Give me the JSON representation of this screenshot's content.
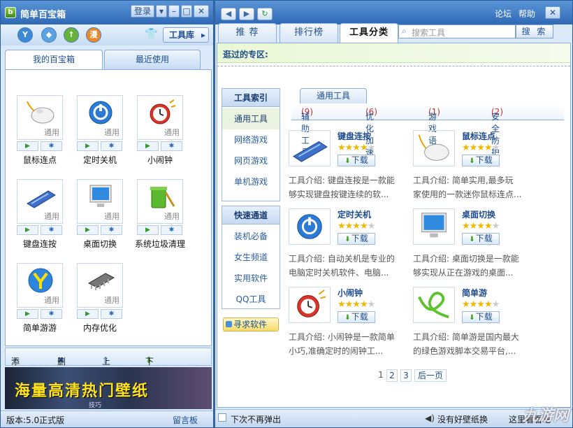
{
  "left": {
    "title": "简单百宝箱",
    "login": "登录",
    "toolbox": "工具库",
    "tabs": [
      "我的百宝箱",
      "最近使用"
    ],
    "tag": "通用",
    "tiles": [
      {
        "name": "鼠标连点",
        "icon": "mouse-icon"
      },
      {
        "name": "定时关机",
        "icon": "power-icon"
      },
      {
        "name": "小闹钟",
        "icon": "alarm-clock-icon"
      },
      {
        "name": "键盘连按",
        "icon": "keyboard-icon"
      },
      {
        "name": "桌面切换",
        "icon": "monitor-icon"
      },
      {
        "name": "系统垃圾清理",
        "icon": "trash-icon"
      },
      {
        "name": "简单游游",
        "icon": "y-logo-icon"
      },
      {
        "name": "内存优化",
        "icon": "memory-chip-icon"
      }
    ],
    "footer": {
      "add": "添加",
      "delete": "删除",
      "upload": "上传",
      "download": "下载"
    },
    "banner": {
      "text": "海量高清热门壁纸",
      "sub": "技巧"
    },
    "status": {
      "version": "版本:5.0正式版",
      "board": "留言板"
    }
  },
  "right": {
    "links": {
      "forum": "论坛",
      "help": "帮助"
    },
    "tabs": [
      "推 荐",
      "排行榜",
      "工具分类"
    ],
    "search": {
      "placeholder": "搜索工具",
      "button": "搜 索"
    },
    "visited": "逛过的专区:",
    "index": {
      "title": "工具索引",
      "items": [
        "通用工具",
        "网络游戏",
        "网页游戏",
        "单机游戏"
      ]
    },
    "quick": {
      "title": "快速通道",
      "items": [
        "装机必备",
        "女生频道",
        "实用软件",
        "QQ工具"
      ]
    },
    "seek": "寻求软件",
    "group_tab": "通用工具",
    "categories": [
      {
        "name": "辅助工具",
        "count": "(9)"
      },
      {
        "name": "优化加速",
        "count": "(6)"
      },
      {
        "name": "游戏语音",
        "count": "(1)"
      },
      {
        "name": "安全防护",
        "count": "(2)"
      }
    ],
    "download_label": "下载",
    "cards": [
      {
        "name": "键盘连按",
        "rating": 4.5,
        "desc1": "工具介绍: 键盘连按是一款能",
        "desc2": "够实现键盘按键连续的软...",
        "icon": "keyboard-icon"
      },
      {
        "name": "鼠标连点",
        "rating": 4,
        "desc1": "工具介绍: 简单实用,最多玩",
        "desc2": "家使用的一款迷你鼠标连点...",
        "icon": "mouse-icon"
      },
      {
        "name": "定时关机",
        "rating": 4.5,
        "desc1": "工具介绍: 自动关机是专业的",
        "desc2": "电脑定时关机软件、电脑...",
        "icon": "power-icon"
      },
      {
        "name": "桌面切换",
        "rating": 4.5,
        "desc1": "工具介绍: 桌面切换是一款能",
        "desc2": "够实现从正在游戏的桌面...",
        "icon": "monitor-icon"
      },
      {
        "name": "小闹钟",
        "rating": 4.5,
        "desc1": "工具介绍: 小闹钟是一款简单",
        "desc2": "小巧,准确定时的闹钟工...",
        "icon": "alarm-clock-icon"
      },
      {
        "name": "简单游",
        "rating": 4.5,
        "desc1": "工具介绍: 简单游是国内最大",
        "desc2": "的绿色游戏脚本交易平台,...",
        "icon": "green-rope-icon"
      }
    ],
    "pages": [
      "1",
      "2",
      "3",
      "后一页"
    ],
    "status": {
      "no_popup": "下次不再弹出",
      "wallpaper": "没有好壁纸换",
      "look": "这里看看吧"
    }
  },
  "watermark": "九游网"
}
